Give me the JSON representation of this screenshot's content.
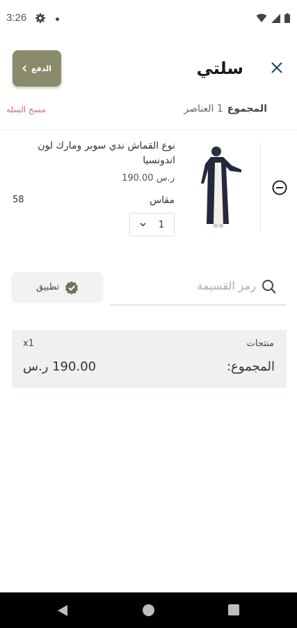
{
  "status": {
    "time": "3:26"
  },
  "header": {
    "title": "سلتي",
    "checkout_label": "الدفع"
  },
  "summary": {
    "label": "المجموع",
    "items_count": "1 العناصر",
    "clear_label": "مسح السله"
  },
  "item": {
    "name": "نوع القماش ندي سوبر ومارك لون اندونسيا",
    "price": "ر.س 190.00",
    "size_label": "مقاس",
    "size_value": "58",
    "quantity": "1"
  },
  "coupon": {
    "placeholder": "رمز القسيمة",
    "apply_label": "تطبيق"
  },
  "totals": {
    "products_label": "منتجات",
    "products_count": "x1",
    "total_label": "المجموع:",
    "total_value": "190.00 ر.س"
  },
  "colors": {
    "accent": "#8a8b6a",
    "danger": "#e06a6a",
    "totals_bg": "#eef0f1"
  }
}
